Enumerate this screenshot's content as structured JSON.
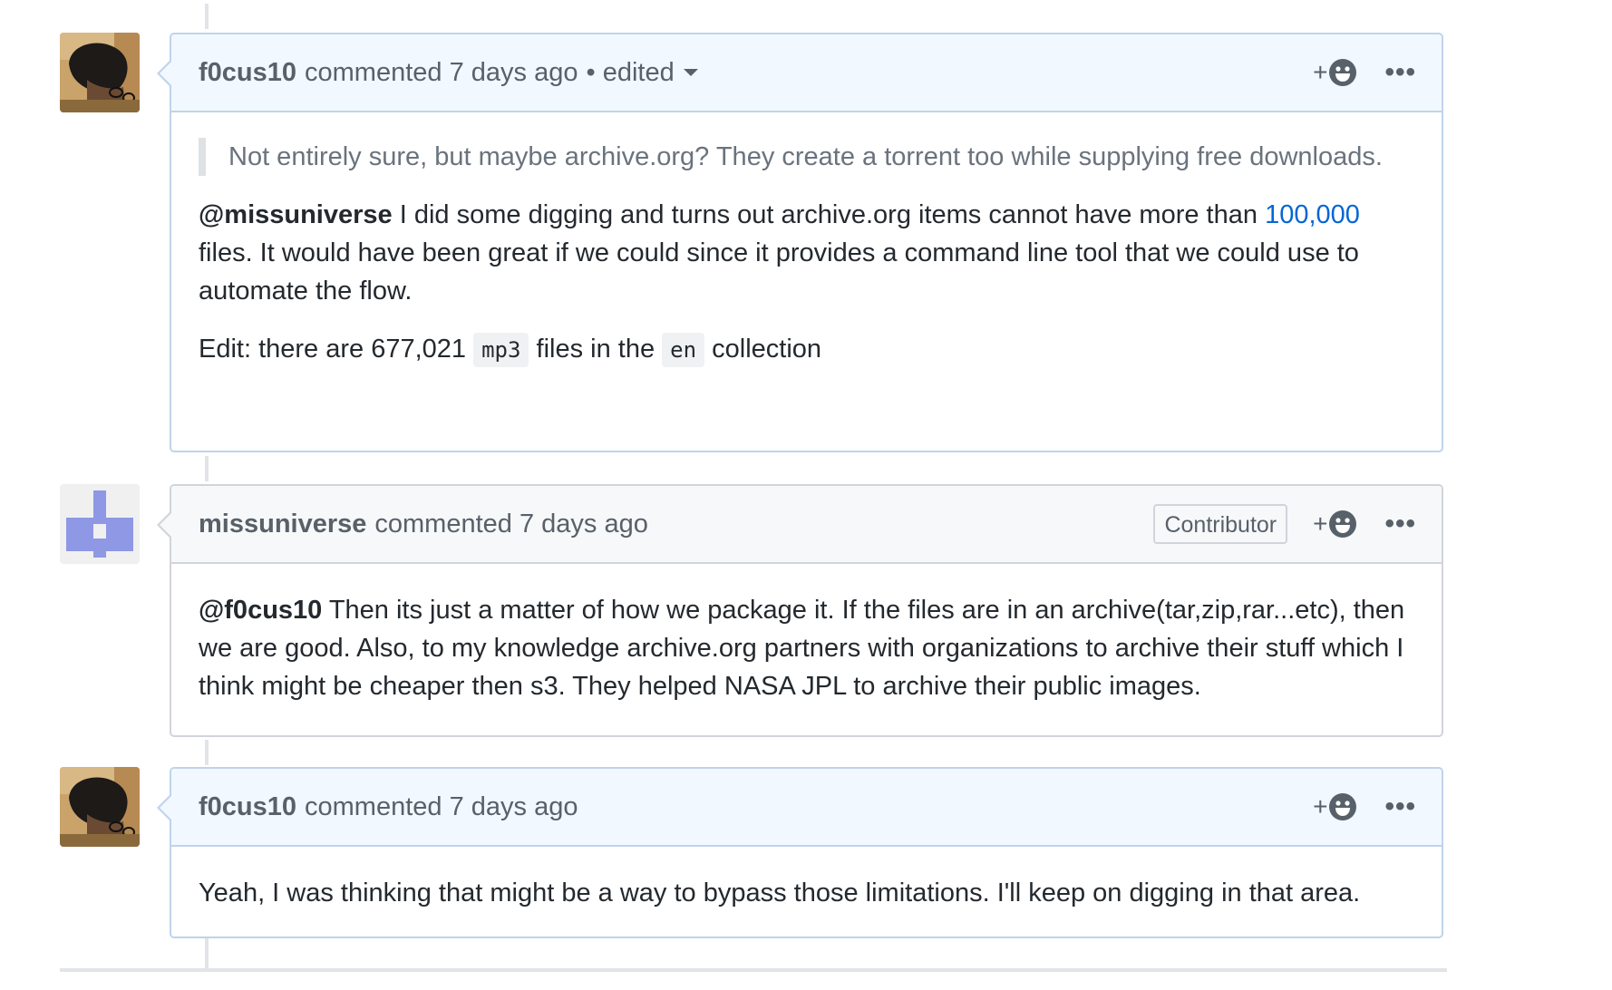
{
  "comments": [
    {
      "author": "f0cus10",
      "action": "commented 7 days ago",
      "edited": "• edited",
      "quote": "Not entirely sure, but maybe archive.org? They create a torrent too while supplying free downloads.",
      "p1_mention": "@missuniverse",
      "p1_text_a": " I did some digging and turns out archive.org items cannot have more than ",
      "p1_link": "100,000",
      "p1_text_b": " files. It would have been great if we could since it provides a command line tool that we could use to automate the flow.",
      "p2_a": "Edit: there are 677,021 ",
      "p2_code1": "mp3",
      "p2_b": " files in the ",
      "p2_code2": "en",
      "p2_c": " collection"
    },
    {
      "author": "missuniverse",
      "action": "commented 7 days ago",
      "badge": "Contributor",
      "mention": "@f0cus10",
      "text": " Then its just a matter of how we package it. If the files are in an archive(tar,zip,rar...etc), then we are good. Also, to my knowledge archive.org partners with organizations to archive their stuff which I think might be cheaper then s3. They helped NASA JPL to archive their public images."
    },
    {
      "author": "f0cus10",
      "action": "commented 7 days ago",
      "text": "Yeah, I was thinking that might be a way to bypass those limitations. I'll keep on digging in that area."
    }
  ],
  "reaction_plus": "+",
  "more_dots": "•••",
  "colors": {
    "header_blue": "#f1f8ff",
    "border_blue": "#c0d3eb",
    "header_gray": "#f6f8fa",
    "border_gray": "#d1d5da",
    "link": "#0366d6",
    "identicon": "#8e98e4"
  },
  "icons": [
    "smiley-icon",
    "kebab-horizontal-icon",
    "caret-down-icon"
  ]
}
